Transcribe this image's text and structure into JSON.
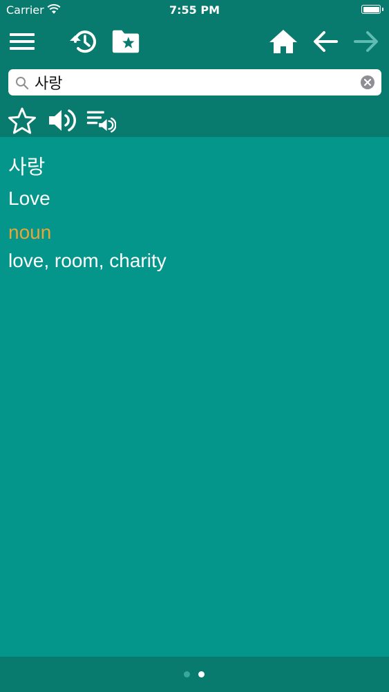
{
  "status_bar": {
    "carrier": "Carrier",
    "time": "7:55 PM"
  },
  "toolbar": {
    "icons": [
      "menu-icon",
      "history-icon",
      "favorites-folder-icon",
      "home-icon",
      "back-arrow-icon",
      "forward-arrow-icon"
    ],
    "forward_enabled": false
  },
  "search": {
    "value": "사랑",
    "placeholder": ""
  },
  "actions": {
    "icons": [
      "star-icon",
      "speaker-icon",
      "playlist-audio-icon"
    ]
  },
  "entry": {
    "headword": "사랑",
    "translation": "Love",
    "part_of_speech": "noun",
    "meanings": "love, room, charity"
  },
  "pager": {
    "page_count": 2,
    "current_page": 2
  },
  "colors": {
    "header": "#087a6e",
    "content": "#04968a",
    "pos_label": "#e8a53a",
    "disabled_icon": "#5fbcb2"
  }
}
